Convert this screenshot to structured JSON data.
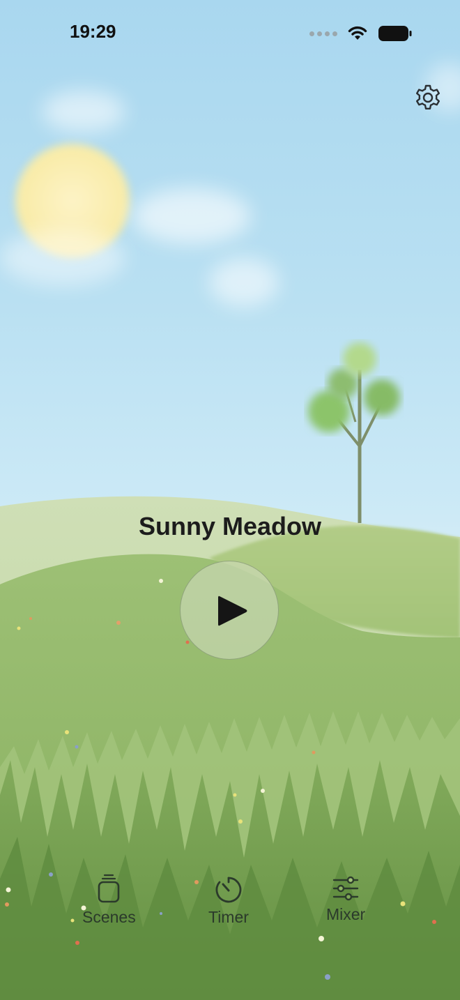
{
  "status_bar": {
    "time": "19:29"
  },
  "header": {
    "settings_icon": "gear-icon"
  },
  "scene": {
    "title": "Sunny Meadow",
    "play_icon": "play-icon"
  },
  "tab_bar": {
    "items": [
      {
        "label": "Scenes",
        "icon": "scenes-icon"
      },
      {
        "label": "Timer",
        "icon": "timer-icon"
      },
      {
        "label": "Mixer",
        "icon": "mixer-icon"
      }
    ]
  },
  "colors": {
    "sky_top": "#a9d7ef",
    "hill_far": "#c5d9a8",
    "hill_mid": "#8db36a",
    "grass": "#6f9a4c",
    "text": "#1c1c1c"
  }
}
